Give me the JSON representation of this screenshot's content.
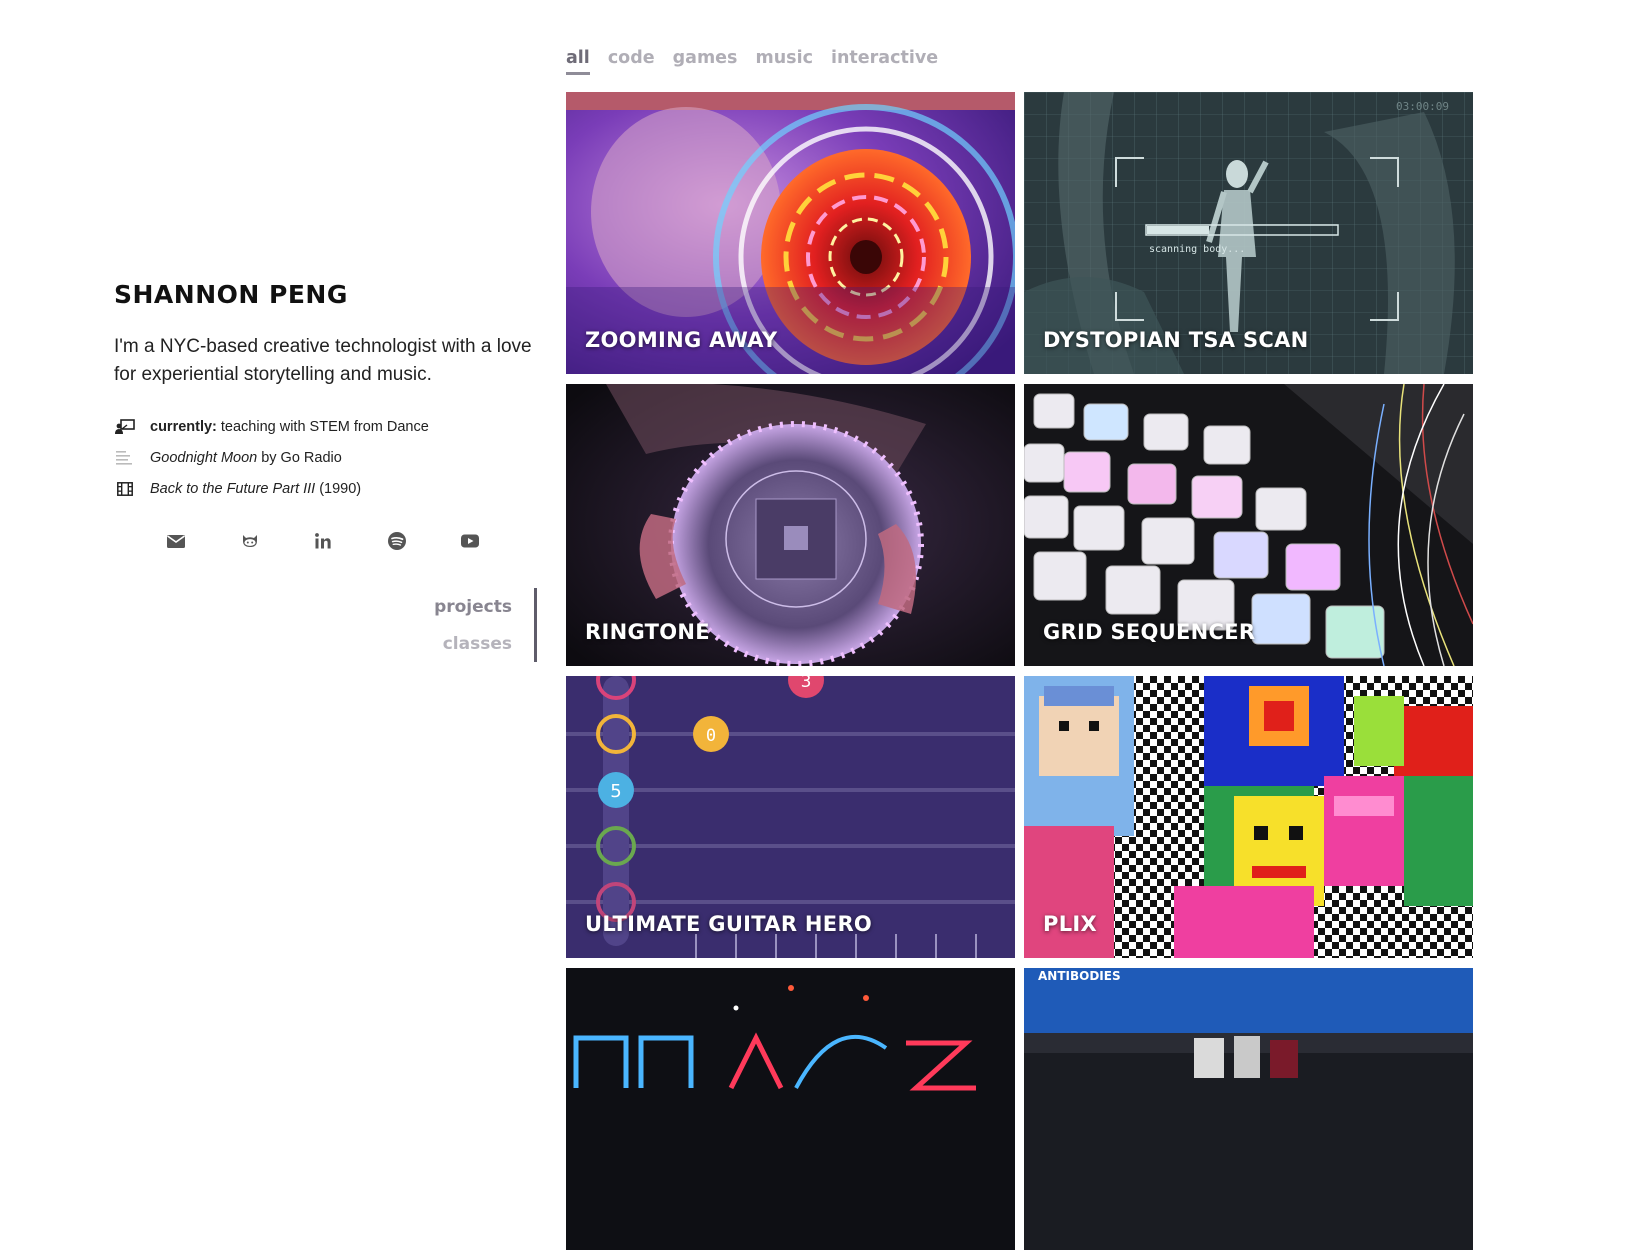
{
  "profile": {
    "name": "SHANNON PENG",
    "bio": "I'm a NYC-based creative technologist with a love for experiential storytelling and music.",
    "status": [
      {
        "icon": "teacher-icon",
        "label": "currently:",
        "text": "teaching with STEM from Dance"
      },
      {
        "icon": "lyrics-icon",
        "title": "Goodnight Moon",
        "text": "by Go Radio"
      },
      {
        "icon": "film-icon",
        "title": "Back to the Future Part III",
        "text": "(1990)"
      }
    ],
    "socials": [
      "email-icon",
      "github-icon",
      "linkedin-icon",
      "spotify-icon",
      "youtube-icon"
    ]
  },
  "side_nav": {
    "projects": "projects",
    "classes": "classes"
  },
  "filters": [
    {
      "label": "all",
      "active": true
    },
    {
      "label": "code",
      "active": false
    },
    {
      "label": "games",
      "active": false
    },
    {
      "label": "music",
      "active": false
    },
    {
      "label": "interactive",
      "active": false
    }
  ],
  "projects": [
    {
      "title": "ZOOMING AWAY"
    },
    {
      "title": "DYSTOPIAN TSA SCAN",
      "overlay_text": "scanning body...",
      "timecode": "03:00:09"
    },
    {
      "title": "RINGTONE"
    },
    {
      "title": "GRID SEQUENCER"
    },
    {
      "title": "ULTIMATE GUITAR HERO",
      "notes": [
        "3",
        "0",
        "5"
      ]
    },
    {
      "title": "PLIX"
    },
    {
      "title": ""
    },
    {
      "title": "",
      "banner_text": "ANTIBODIES"
    }
  ],
  "colors": {
    "accent_nav": "#5f5c6a",
    "filter_inactive": "#b0aeb6",
    "filter_active": "#6f6c78"
  }
}
